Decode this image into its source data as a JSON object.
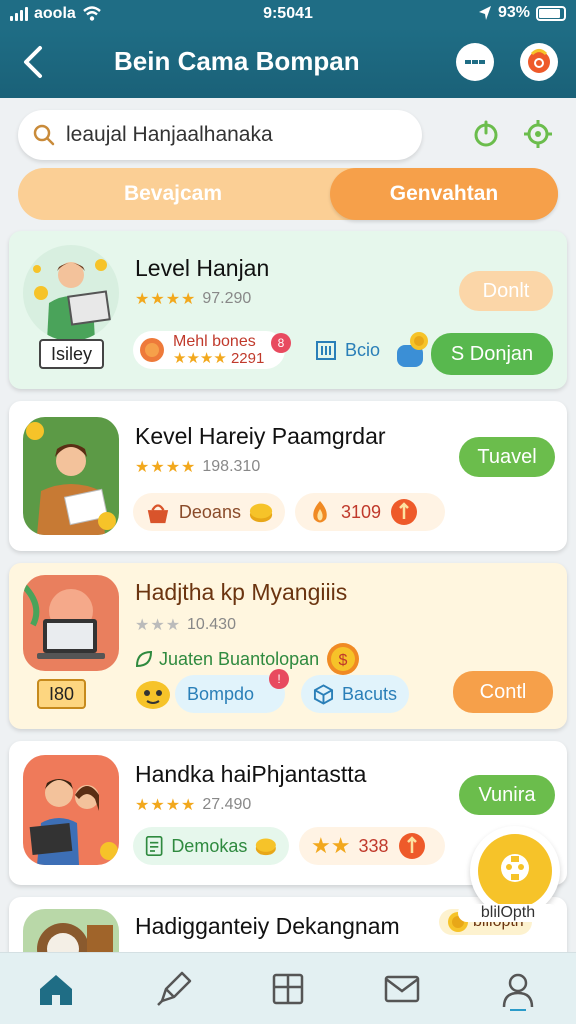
{
  "status": {
    "carrier": "aoola",
    "time": "9:5041",
    "battery": "93%"
  },
  "header": {
    "title": "Bein Cama Bompan"
  },
  "search": {
    "value": "leaujal Hanjaalhanaka"
  },
  "tabs": [
    {
      "label": "Bevajcam",
      "active": false
    },
    {
      "label": "Genvahtan",
      "active": true
    }
  ],
  "cards": [
    {
      "title": "Level Hanjan",
      "rating": "97.290",
      "badge": "Isiley",
      "pill1": "Mehl bones",
      "pill1_sub": "2291",
      "pill2": "Bcio",
      "action1": "Donlt",
      "action2": "S Donjan"
    },
    {
      "title": "Kevel Hareiy Paamgrdar",
      "rating": "198.310",
      "pill1": "Deoans",
      "pill2": "3109",
      "action": "Tuavel"
    },
    {
      "title": "Hadjtha kp Myangiiis",
      "rating": "10.430",
      "sub": "Juaten Buantolopan",
      "badge": "I80",
      "pill1": "Bompdo",
      "pill2": "Bacuts",
      "action": "Contl"
    },
    {
      "title": "Handka haiPhjantastta",
      "rating": "27.490",
      "pill1": "Demokas",
      "pill2": "338",
      "action": "Vunira"
    },
    {
      "title": "Hadigganteiy Dekangnam",
      "tag": "blilopth"
    }
  ],
  "fab": {
    "label": "blilOpth"
  },
  "colors": {
    "primary": "#1f6d85",
    "accent_orange": "#f6a04a",
    "accent_green": "#6bbd4c",
    "card_green": "#e6f7ec",
    "card_yellow": "#fff6df"
  },
  "nav": [
    "home-icon",
    "pen-icon",
    "grid-icon",
    "mail-icon",
    "profile-icon"
  ]
}
